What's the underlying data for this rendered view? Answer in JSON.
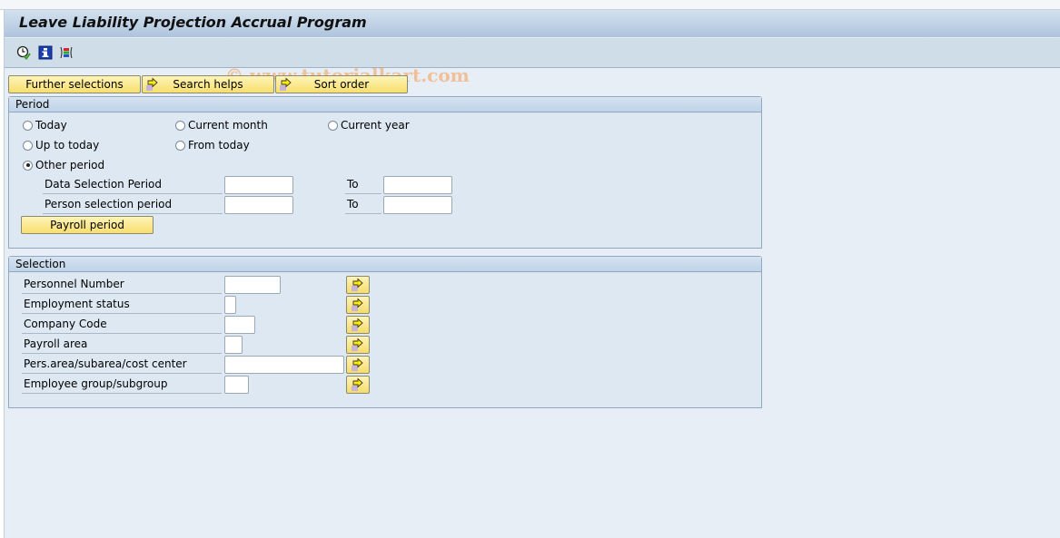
{
  "window": {
    "title": "Leave Liability Projection Accrual Program",
    "watermark": "© www.tutorialkart.com"
  },
  "toolbar": {
    "icons": [
      {
        "name": "execute-clock-icon",
        "tooltip": ""
      },
      {
        "name": "info-icon",
        "tooltip": ""
      },
      {
        "name": "variant-icon",
        "tooltip": ""
      }
    ]
  },
  "buttons": {
    "further_selections": "Further selections",
    "search_helps": "Search helps",
    "sort_order": "Sort order"
  },
  "period": {
    "title": "Period",
    "options": [
      {
        "label": "Today",
        "selected": false
      },
      {
        "label": "Current month",
        "selected": false
      },
      {
        "label": "Current year",
        "selected": false
      },
      {
        "label": "Up to today",
        "selected": false
      },
      {
        "label": "From today",
        "selected": false
      },
      {
        "label": "Other period",
        "selected": true
      }
    ],
    "fields": [
      {
        "label": "Data Selection Period",
        "from": "",
        "to_label": "To",
        "to": ""
      },
      {
        "label": "Person selection period",
        "from": "",
        "to_label": "To",
        "to": ""
      }
    ],
    "payroll_button": "Payroll period"
  },
  "selection": {
    "title": "Selection",
    "fields": [
      {
        "label": "Personnel Number",
        "value": ""
      },
      {
        "label": "Employment status",
        "value": ""
      },
      {
        "label": "Company Code",
        "value": ""
      },
      {
        "label": "Payroll area",
        "value": ""
      },
      {
        "label": "Pers.area/subarea/cost center",
        "value": ""
      },
      {
        "label": "Employee group/subgroup",
        "value": ""
      }
    ]
  },
  "colors": {
    "button_yellow": "#f7df6e",
    "group_bg": "#dde8f2",
    "title_bar": "#aec4dd"
  }
}
